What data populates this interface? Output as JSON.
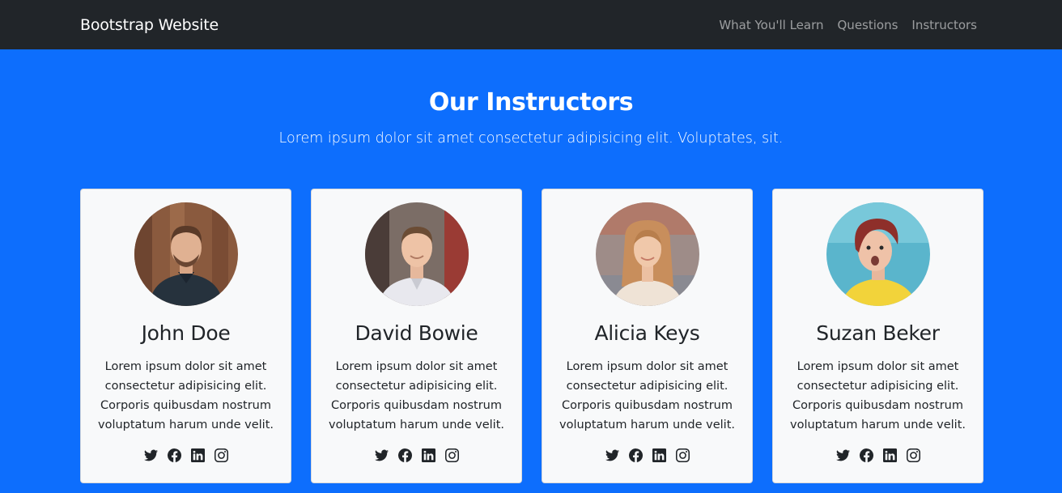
{
  "navbar": {
    "brand": "Bootstrap Website",
    "links": [
      "What You'll Learn",
      "Questions",
      "Instructors"
    ]
  },
  "section": {
    "title": "Our Instructors",
    "lead": "Lorem ipsum dolor sit amet consectetur adipisicing elit. Voluptates, sit."
  },
  "colors": {
    "navbar_bg": "#212529",
    "section_bg": "#0d6efd",
    "card_bg": "#f8f9fa"
  },
  "instructors": [
    {
      "name": "John Doe",
      "bio": "Lorem ipsum dolor sit amet consectetur adipisicing elit. Corporis quibusdam nostrum voluptatum harum unde velit.",
      "socials": [
        "twitter-icon",
        "facebook-icon",
        "linkedin-icon",
        "instagram-icon"
      ]
    },
    {
      "name": "David Bowie",
      "bio": "Lorem ipsum dolor sit amet consectetur adipisicing elit. Corporis quibusdam nostrum voluptatum harum unde velit.",
      "socials": [
        "twitter-icon",
        "facebook-icon",
        "linkedin-icon",
        "instagram-icon"
      ]
    },
    {
      "name": "Alicia Keys",
      "bio": "Lorem ipsum dolor sit amet consectetur adipisicing elit. Corporis quibusdam nostrum voluptatum harum unde velit.",
      "socials": [
        "twitter-icon",
        "facebook-icon",
        "linkedin-icon",
        "instagram-icon"
      ]
    },
    {
      "name": "Suzan Beker",
      "bio": "Lorem ipsum dolor sit amet consectetur adipisicing elit. Corporis quibusdam nostrum voluptatum harum unde velit.",
      "socials": [
        "twitter-icon",
        "facebook-icon",
        "linkedin-icon",
        "instagram-icon"
      ]
    }
  ]
}
